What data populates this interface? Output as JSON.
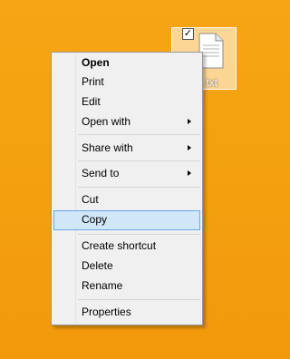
{
  "desktop": {
    "file": {
      "label_partial": ".txt"
    }
  },
  "context_menu": {
    "items": [
      {
        "label": "Open"
      },
      {
        "label": "Print"
      },
      {
        "label": "Edit"
      },
      {
        "label": "Open with"
      },
      {
        "label": "Share with"
      },
      {
        "label": "Send to"
      },
      {
        "label": "Cut"
      },
      {
        "label": "Copy"
      },
      {
        "label": "Create shortcut"
      },
      {
        "label": "Delete"
      },
      {
        "label": "Rename"
      },
      {
        "label": "Properties"
      }
    ]
  }
}
